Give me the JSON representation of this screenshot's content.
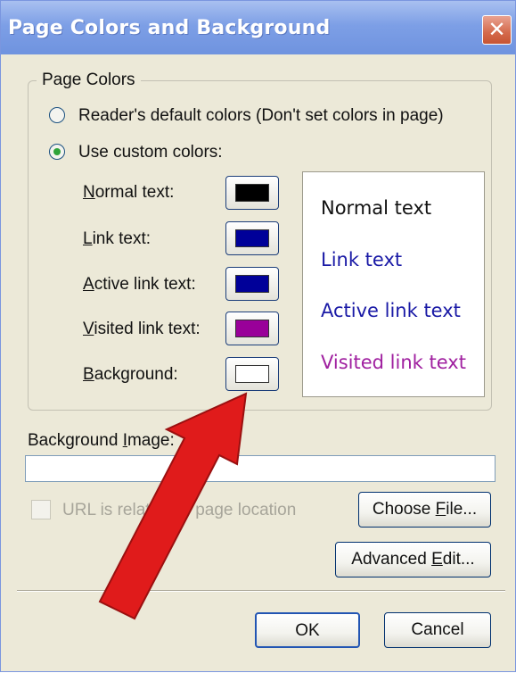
{
  "window": {
    "title": "Page Colors and Background",
    "close_label": "✕"
  },
  "page_colors": {
    "legend": "Page Colors",
    "radio_default": {
      "label": "Reader's default colors (Don't set colors in page)",
      "selected": false
    },
    "radio_custom": {
      "label": "Use custom colors:",
      "selected": true
    },
    "rows": [
      {
        "label_u": "N",
        "label_rest": "ormal text:",
        "color": "#000000"
      },
      {
        "label_u": "L",
        "label_rest": "ink text:",
        "color": "#000099"
      },
      {
        "label_u": "A",
        "label_rest": "ctive link text:",
        "color": "#000099"
      },
      {
        "label_u": "V",
        "label_rest": "isited link text:",
        "color": "#990099"
      },
      {
        "label_u": "B",
        "label_rest": "ackground:",
        "color": "#ffffff"
      }
    ]
  },
  "preview": {
    "normal": {
      "text": "Normal text",
      "color": "#111111"
    },
    "link": {
      "text": "Link text",
      "color": "#1a1aa6"
    },
    "active": {
      "text": "Active link text",
      "color": "#1a1aa6"
    },
    "visited": {
      "text": "Visited link text",
      "color": "#a020a0"
    }
  },
  "background_image": {
    "label_pre": "Background ",
    "label_u": "I",
    "label_post": "mage:",
    "value": ""
  },
  "url_relative": {
    "label": "URL is relative to page location",
    "checked": false
  },
  "buttons": {
    "choose_file_pre": "Choose ",
    "choose_file_u": "F",
    "choose_file_post": "ile...",
    "advanced_pre": "Advanced ",
    "advanced_u": "E",
    "advanced_post": "dit...",
    "ok": "OK",
    "cancel": "Cancel"
  },
  "annotation": {
    "arrow_color": "#e01b1b"
  }
}
